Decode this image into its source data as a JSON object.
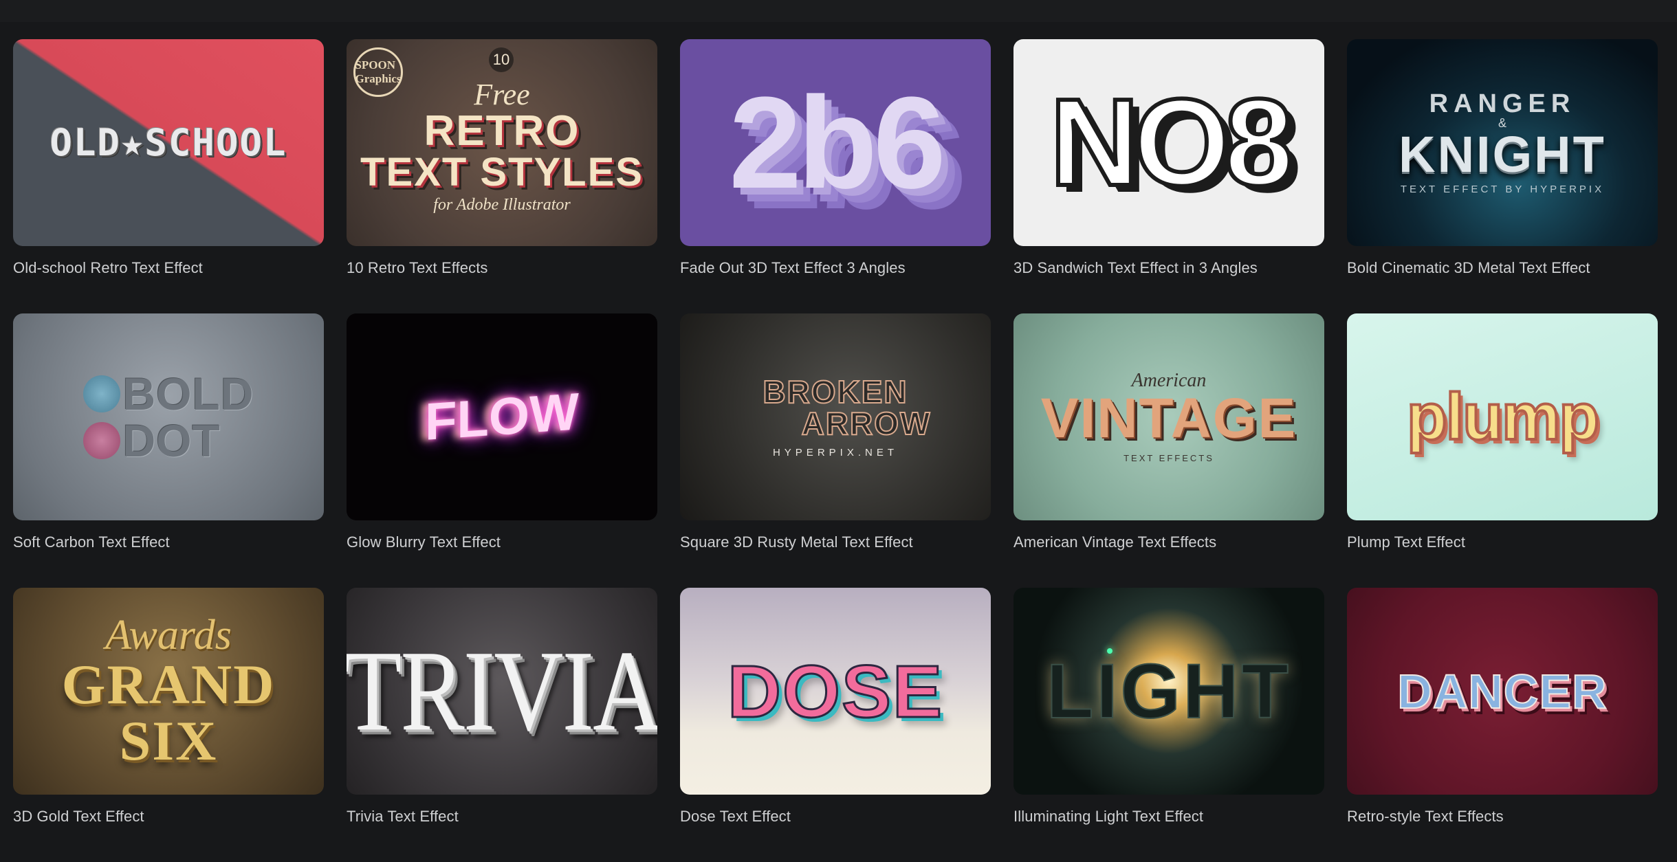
{
  "colors": {
    "background": "#17181a",
    "caption": "#cfd0d2"
  },
  "items": [
    {
      "title": "Old-school Retro Text Effect",
      "art": [
        "OLD★SCHOOL"
      ]
    },
    {
      "title": "10 Retro Text Effects",
      "art": [
        "10",
        "SPOON Graphics",
        "Free",
        "RETRO",
        "TEXT STYLES",
        "for Adobe Illustrator"
      ]
    },
    {
      "title": "Fade Out 3D Text Effect 3 Angles",
      "art": [
        "2b6"
      ]
    },
    {
      "title": "3D Sandwich Text Effect in 3 Angles",
      "art": [
        "NO8"
      ]
    },
    {
      "title": "Bold Cinematic 3D Metal Text Effect",
      "art": [
        "RANGER",
        "&",
        "KNIGHT",
        "TEXT EFFECT BY HYPERPIX"
      ]
    },
    {
      "title": "Soft Carbon Text Effect",
      "art": [
        "BOLD",
        "DOT"
      ]
    },
    {
      "title": "Glow Blurry Text Effect",
      "art": [
        "FLOW"
      ]
    },
    {
      "title": "Square 3D Rusty Metal Text Effect",
      "art": [
        "BROKEN",
        "ARROW",
        "HYPERPIX.NET"
      ]
    },
    {
      "title": "American Vintage Text Effects",
      "art": [
        "American",
        "VINTAGE",
        "TEXT EFFECTS"
      ]
    },
    {
      "title": "Plump Text Effect",
      "art": [
        "plump"
      ]
    },
    {
      "title": "3D Gold Text Effect",
      "art": [
        "Awards",
        "GRAND",
        "SIX"
      ]
    },
    {
      "title": "Trivia Text Effect",
      "art": [
        "TRIVIA"
      ]
    },
    {
      "title": "Dose Text Effect",
      "art": [
        "DOSE"
      ]
    },
    {
      "title": "Illuminating Light Text Effect",
      "art": [
        "LIGHT"
      ]
    },
    {
      "title": "Retro-style Text Effects",
      "art": [
        "DANCER"
      ]
    }
  ]
}
